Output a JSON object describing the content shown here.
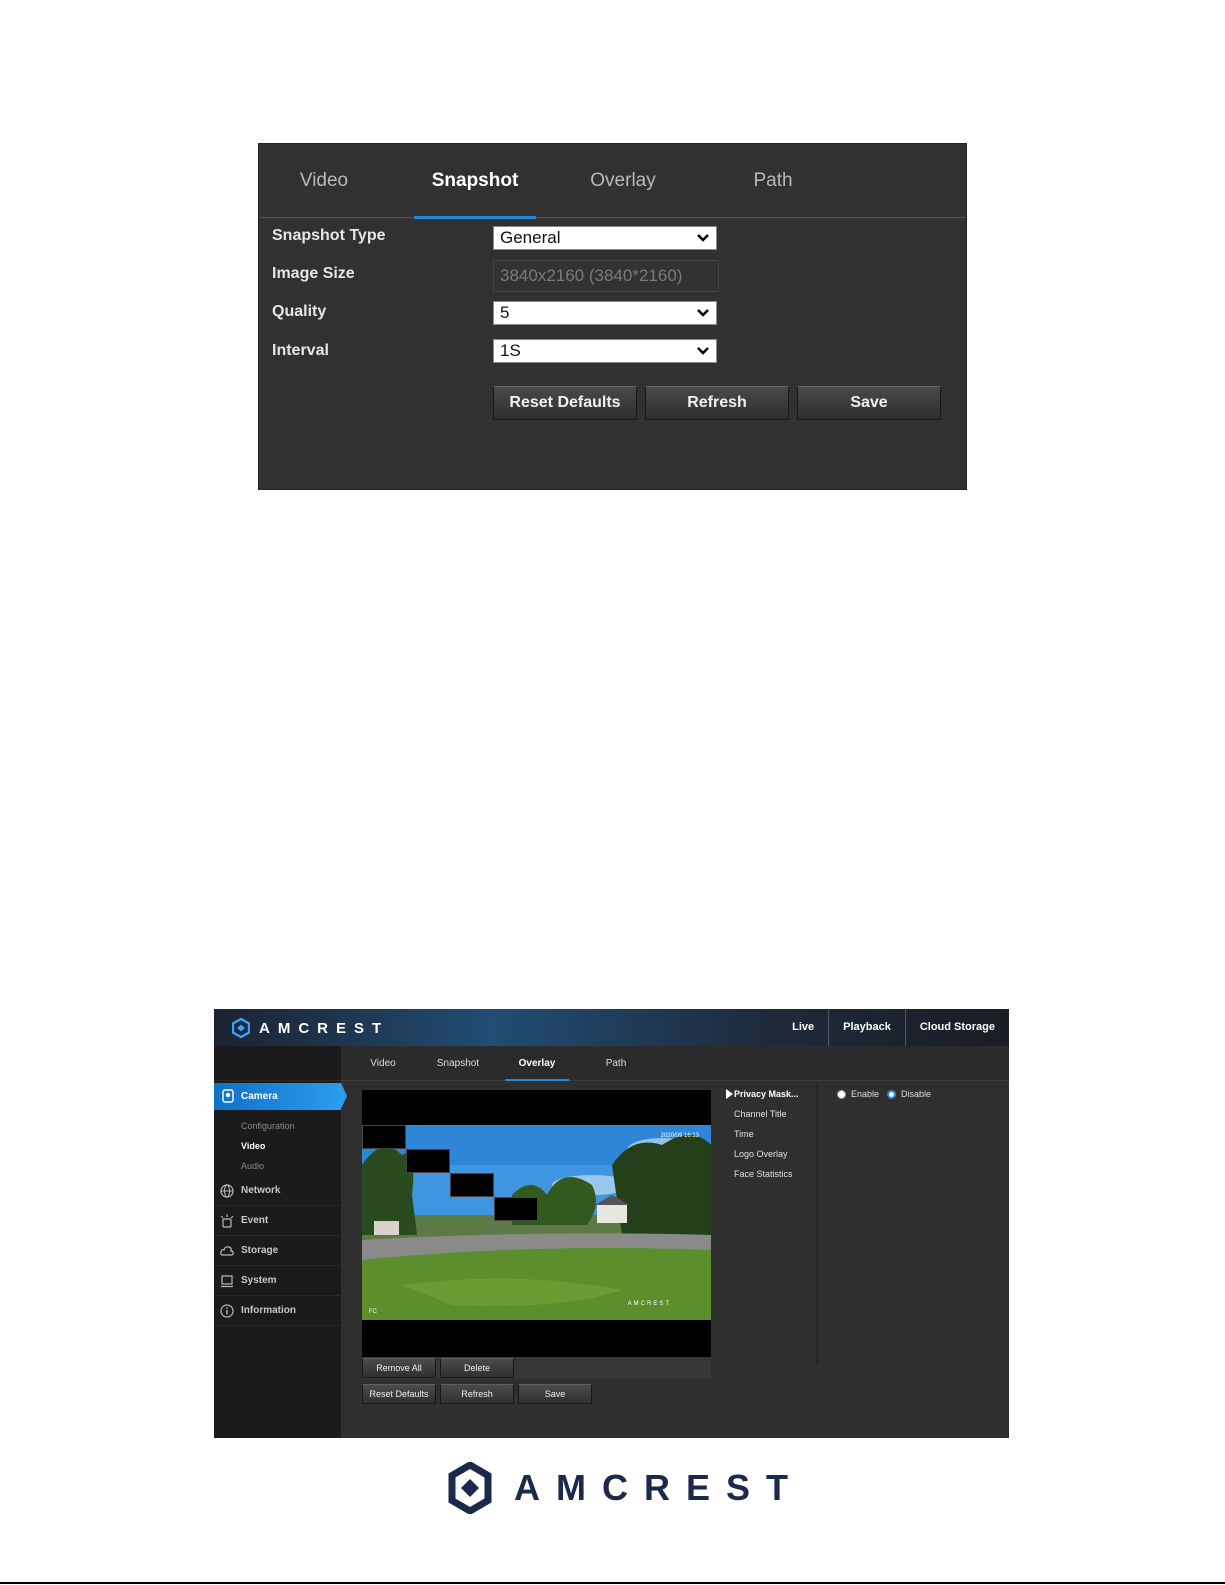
{
  "snapshot_panel": {
    "tabs": [
      "Video",
      "Snapshot",
      "Overlay",
      "Path"
    ],
    "active_tab": "Snapshot",
    "fields": {
      "snapshot_type": {
        "label": "Snapshot Type",
        "value": "General"
      },
      "image_size": {
        "label": "Image Size",
        "value": "3840x2160 (3840*2160)"
      },
      "quality": {
        "label": "Quality",
        "value": "5"
      },
      "interval": {
        "label": "Interval",
        "value": "1S"
      }
    },
    "buttons": {
      "reset": "Reset Defaults",
      "refresh": "Refresh",
      "save": "Save"
    }
  },
  "overlay_panel": {
    "brand": "AMCREST",
    "top_nav": [
      "Live",
      "Playback",
      "Cloud Storage"
    ],
    "sidebar": {
      "active_section": "Camera",
      "camera_sub": [
        "Configuration",
        "Video",
        "Audio"
      ],
      "active_sub": "Video",
      "sections": [
        "Network",
        "Event",
        "Storage",
        "System",
        "Information"
      ]
    },
    "tabs": [
      "Video",
      "Snapshot",
      "Overlay",
      "Path"
    ],
    "active_tab": "Overlay",
    "video": {
      "timestamp": "2020/09 16:13",
      "watermark": "AMCREST",
      "corner_label": "FC"
    },
    "video_buttons": {
      "remove_all": "Remove All",
      "delete": "Delete"
    },
    "buttons": {
      "reset": "Reset Defaults",
      "refresh": "Refresh",
      "save": "Save"
    },
    "overlay_menu": [
      "Privacy Mask...",
      "Channel Title",
      "Time",
      "Logo Overlay",
      "Face Statistics"
    ],
    "active_menu": "Privacy Mask...",
    "privacy_mask": {
      "enable_label": "Enable",
      "disable_label": "Disable",
      "selected": "Disable"
    }
  },
  "footer": {
    "brand": "AMCREST"
  },
  "colors": {
    "accent": "#1e8ae0",
    "panel_bg": "#313131",
    "brand_navy": "#1b2a4a"
  }
}
